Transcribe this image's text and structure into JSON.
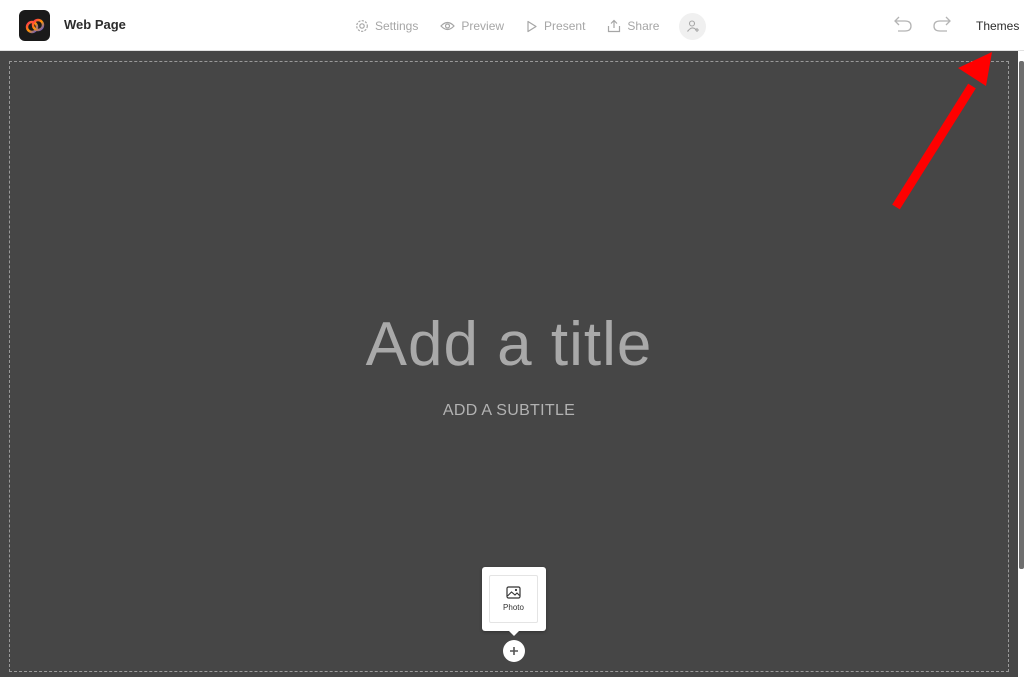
{
  "header": {
    "doc_title": "Web Page",
    "toolbar": [
      {
        "name": "settings",
        "label": "Settings",
        "icon": "gear-icon"
      },
      {
        "name": "preview",
        "label": "Preview",
        "icon": "eye-icon"
      },
      {
        "name": "present",
        "label": "Present",
        "icon": "play-icon"
      },
      {
        "name": "share",
        "label": "Share",
        "icon": "share-icon"
      }
    ],
    "themes_label": "Themes"
  },
  "canvas": {
    "title_placeholder": "Add a title",
    "subtitle_placeholder": "ADD A SUBTITLE",
    "background_color": "#464646"
  },
  "add_menu": {
    "photo_label": "Photo"
  },
  "colors": {
    "annotation_arrow": "#ff0000"
  }
}
